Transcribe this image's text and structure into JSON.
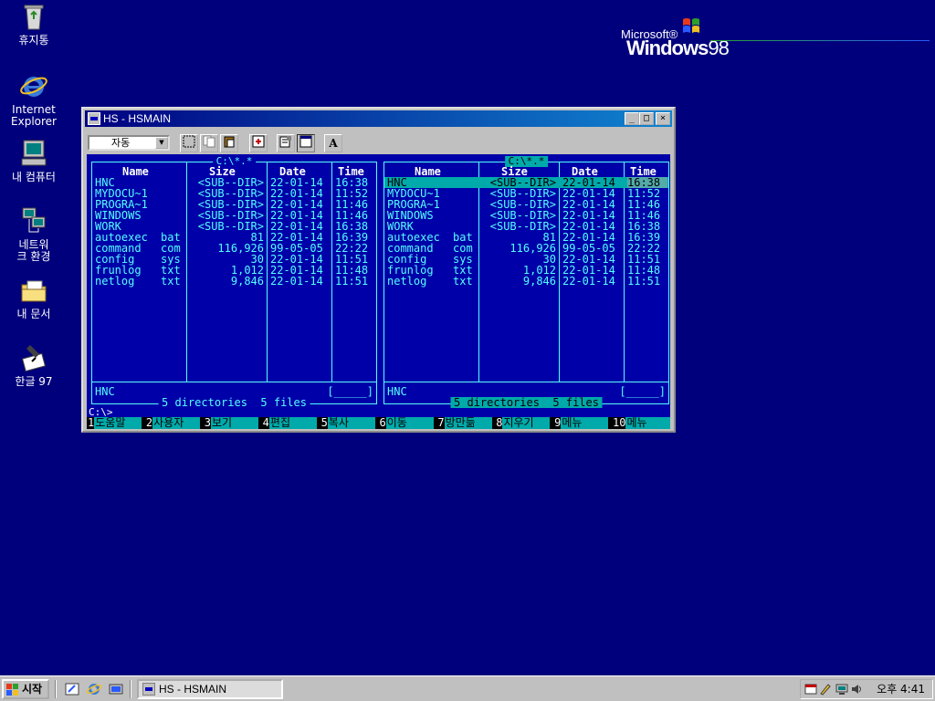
{
  "desktop": {
    "icons": [
      {
        "label": "휴지통",
        "icon": "recycle-bin-icon"
      },
      {
        "label": "Internet Explorer",
        "icon": "internet-explorer-icon"
      },
      {
        "label": "내 컴퓨터",
        "icon": "my-computer-icon"
      },
      {
        "label": "네트워크 환경",
        "icon": "network-icon"
      },
      {
        "label": "내 문서",
        "icon": "my-documents-icon"
      },
      {
        "label": "한글 97",
        "icon": "hangul-97-icon"
      }
    ],
    "logo": {
      "microsoft": "Microsoft®",
      "windows": "Windows",
      "version": "98"
    }
  },
  "window": {
    "title": "HS - HSMAIN",
    "controls": {
      "minimize": "_",
      "maximize": "□",
      "close": "×"
    },
    "toolbar": {
      "font_combo": "자동",
      "font_tool": "A"
    },
    "left_panel": {
      "path": "C:\\*.*",
      "headers": {
        "name": "Name",
        "size": "Size",
        "date": "Date",
        "time": "Time"
      },
      "rows": [
        {
          "name": "HNC",
          "ext": "",
          "size": "<SUB--DIR>",
          "date": "22-01-14",
          "time": "16:38"
        },
        {
          "name": "MYDOCU~1",
          "ext": "",
          "size": "<SUB--DIR>",
          "date": "22-01-14",
          "time": "11:52"
        },
        {
          "name": "PROGRA~1",
          "ext": "",
          "size": "<SUB--DIR>",
          "date": "22-01-14",
          "time": "11:46"
        },
        {
          "name": "WINDOWS",
          "ext": "",
          "size": "<SUB--DIR>",
          "date": "22-01-14",
          "time": "11:46"
        },
        {
          "name": "WORK",
          "ext": "",
          "size": "<SUB--DIR>",
          "date": "22-01-14",
          "time": "16:38"
        },
        {
          "name": "autoexec",
          "ext": "bat",
          "size": "81",
          "date": "22-01-14",
          "time": "16:39"
        },
        {
          "name": "command",
          "ext": "com",
          "size": "116,926",
          "date": "99-05-05",
          "time": "22:22"
        },
        {
          "name": "config",
          "ext": "sys",
          "size": "30",
          "date": "22-01-14",
          "time": "11:51"
        },
        {
          "name": "frunlog",
          "ext": "txt",
          "size": "1,012",
          "date": "22-01-14",
          "time": "11:48"
        },
        {
          "name": "netlog",
          "ext": "txt",
          "size": "9,846",
          "date": "22-01-14",
          "time": "11:51"
        }
      ],
      "current": "HNC",
      "box": "[_____]",
      "summary": "5 directories  5 files"
    },
    "right_panel": {
      "path": "C:\\*.*",
      "headers": {
        "name": "Name",
        "size": "Size",
        "date": "Date",
        "time": "Time"
      },
      "rows": [
        {
          "name": "HNC",
          "ext": "",
          "size": "<SUB--DIR>",
          "date": "22-01-14",
          "time": "16:38"
        },
        {
          "name": "MYDOCU~1",
          "ext": "",
          "size": "<SUB--DIR>",
          "date": "22-01-14",
          "time": "11:52"
        },
        {
          "name": "PROGRA~1",
          "ext": "",
          "size": "<SUB--DIR>",
          "date": "22-01-14",
          "time": "11:46"
        },
        {
          "name": "WINDOWS",
          "ext": "",
          "size": "<SUB--DIR>",
          "date": "22-01-14",
          "time": "11:46"
        },
        {
          "name": "WORK",
          "ext": "",
          "size": "<SUB--DIR>",
          "date": "22-01-14",
          "time": "16:38"
        },
        {
          "name": "autoexec",
          "ext": "bat",
          "size": "81",
          "date": "22-01-14",
          "time": "16:39"
        },
        {
          "name": "command",
          "ext": "com",
          "size": "116,926",
          "date": "99-05-05",
          "time": "22:22"
        },
        {
          "name": "config",
          "ext": "sys",
          "size": "30",
          "date": "22-01-14",
          "time": "11:51"
        },
        {
          "name": "frunlog",
          "ext": "txt",
          "size": "1,012",
          "date": "22-01-14",
          "time": "11:48"
        },
        {
          "name": "netlog",
          "ext": "txt",
          "size": "9,846",
          "date": "22-01-14",
          "time": "11:51"
        }
      ],
      "selected_index": 0,
      "current": "HNC",
      "box": "[_____]",
      "summary": "5 directories  5 files"
    },
    "prompt": "C:\\>",
    "fkeys": [
      {
        "num": "1",
        "label": "도움말"
      },
      {
        "num": "2",
        "label": "사용자"
      },
      {
        "num": "3",
        "label": "보기"
      },
      {
        "num": "4",
        "label": "편집"
      },
      {
        "num": "5",
        "label": "복사"
      },
      {
        "num": "6",
        "label": "이동"
      },
      {
        "num": "7",
        "label": "방만듦"
      },
      {
        "num": "8",
        "label": "지우기"
      },
      {
        "num": "9",
        "label": "메뉴"
      },
      {
        "num": "10",
        "label": "메뉴"
      }
    ]
  },
  "taskbar": {
    "start_label": "시작",
    "task_title": "HS - HSMAIN",
    "clock": "오후 4:41"
  },
  "colors": {
    "desktop": "#00007c",
    "dos_bg": "#0000a8",
    "dos_fg": "#55ffff",
    "highlight": "#00aaaa"
  }
}
